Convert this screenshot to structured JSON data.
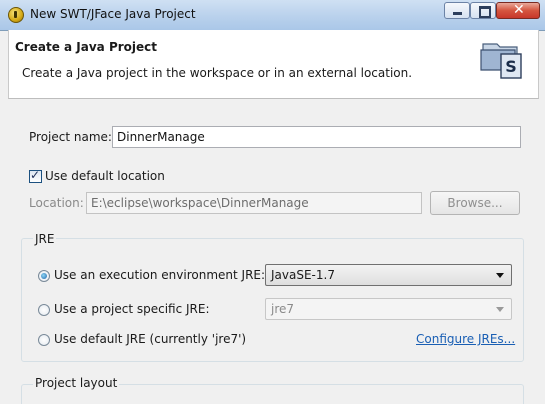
{
  "window": {
    "title": "New SWT/JFace Java Project",
    "minimize_icon": "minimize-icon",
    "maximize_icon": "maximize-icon",
    "close_icon": "close-icon"
  },
  "header": {
    "title": "Create a Java Project",
    "description": "Create a Java project in the workspace or in an external location.",
    "icon": "java-project-wizard-icon"
  },
  "project_name": {
    "label": "Project name:",
    "value": "DinnerManage"
  },
  "default_location": {
    "label": "Use default location",
    "checked": true
  },
  "location": {
    "label": "Location:",
    "value": "E:\\eclipse\\workspace\\DinnerManage",
    "browse_label": "Browse..."
  },
  "jre": {
    "group_label": "JRE",
    "exec_env_label": "Use an execution environment JRE:",
    "exec_env_value": "JavaSE-1.7",
    "specific_label": "Use a project specific JRE:",
    "specific_value": "jre7",
    "default_label": "Use default JRE (currently 'jre7')",
    "configure_link": "Configure JREs..."
  },
  "project_layout": {
    "group_label": "Project layout"
  },
  "colors": {
    "link": "#1a5fb4",
    "titlebar": "#b9d1ec",
    "close_button": "#d5553f"
  }
}
